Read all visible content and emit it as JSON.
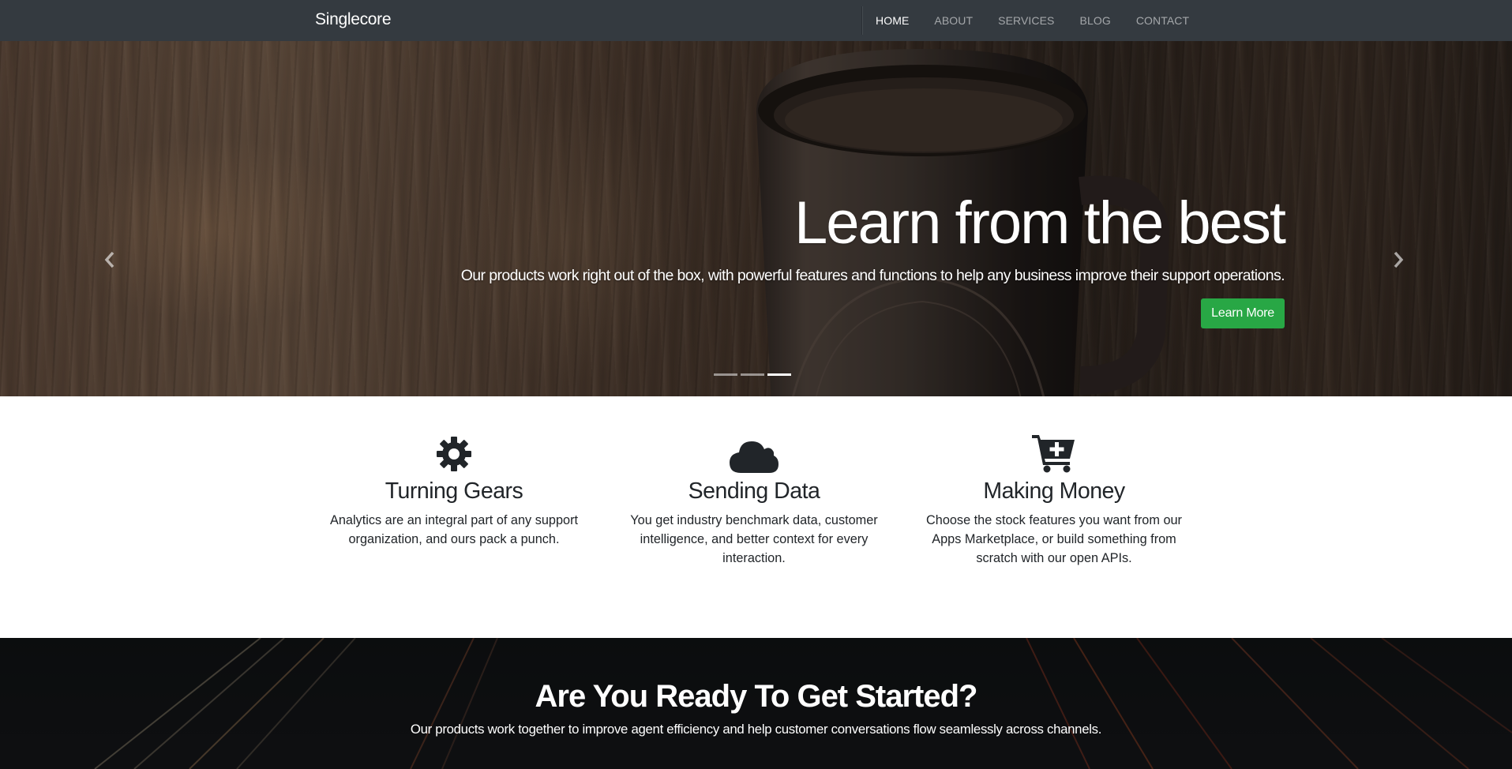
{
  "navbar": {
    "brand": "Singlecore",
    "items": [
      {
        "label": "HOME",
        "active": true
      },
      {
        "label": "ABOUT",
        "active": false
      },
      {
        "label": "SERVICES",
        "active": false
      },
      {
        "label": "BLOG",
        "active": false
      },
      {
        "label": "CONTACT",
        "active": false
      }
    ]
  },
  "hero": {
    "title": "Learn from the best",
    "text": "Our products work right out of the box, with powerful features and functions to help any business improve their support operations.",
    "button_label": "Learn More",
    "prev_icon": "chevron-left-icon",
    "next_icon": "chevron-right-icon",
    "slide_count": 3,
    "active_slide": 3
  },
  "features": [
    {
      "icon": "gear-icon",
      "title": "Turning Gears",
      "text": "Analytics are an integral part of any support organization, and ours pack a punch."
    },
    {
      "icon": "cloud-icon",
      "title": "Sending Data",
      "text": "You get industry benchmark data, customer intelligence, and better context for every interaction."
    },
    {
      "icon": "cart-plus-icon",
      "title": "Making Money",
      "text": "Choose the stock features you want from our Apps Marketplace, or build something from scratch with our open APIs."
    }
  ],
  "cta": {
    "title": "Are You Ready To Get Started?",
    "text": "Our products work together to improve agent efficiency and help customer conversations flow seamlessly across channels."
  },
  "colors": {
    "navbar_bg": "#343a40",
    "button_green": "#28a745",
    "text_dark": "#212529"
  }
}
